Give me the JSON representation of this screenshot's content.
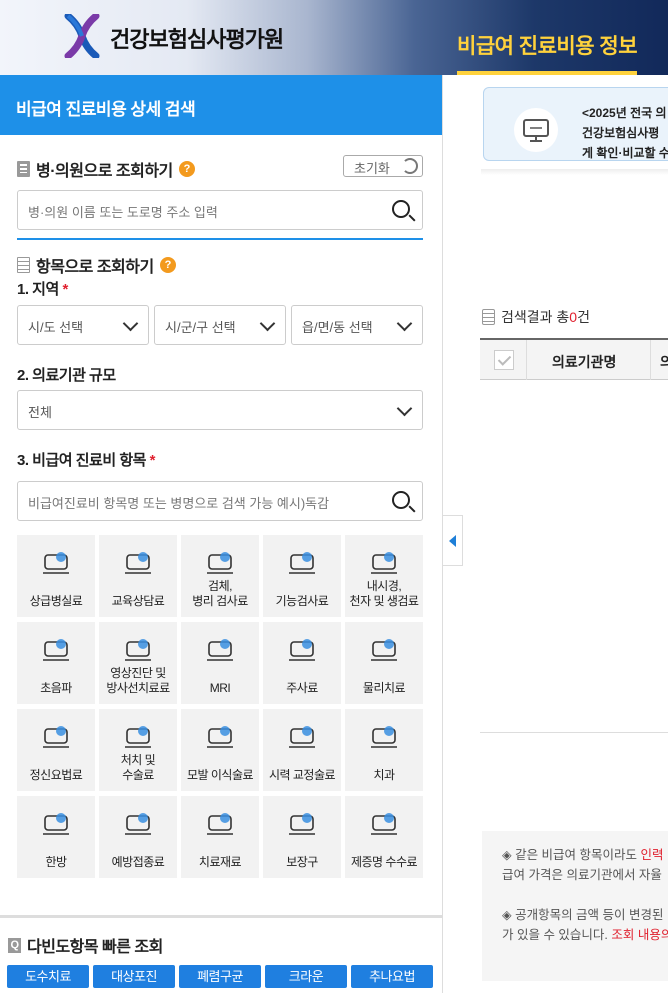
{
  "header": {
    "org_name": "건강보험심사평가원",
    "page_title": "비급여 진료비용 정보"
  },
  "left_panel": {
    "title": "비급여 진료비용 상세 검색",
    "hospital_search": {
      "title": "병·의원으로 조회하기",
      "reset_label": "초기화",
      "placeholder": "병·의원 이름 또는 도로명 주소 입력"
    },
    "item_search": {
      "title": "항목으로 조회하기",
      "region_label": "1. 지역",
      "region_selects": [
        "시/도 선택",
        "시/군/구 선택",
        "읍/면/동 선택"
      ],
      "scale_label": "2. 의료기관 규모",
      "scale_value": "전체",
      "item_label": "3. 비급여 진료비 항목",
      "item_placeholder": "비급여진료비 항목명 또는 병명으로 검색 가능 예시)독감",
      "categories": [
        {
          "label": "상급병실료",
          "icon": "hospital-bed-icon"
        },
        {
          "label": "교육상담료",
          "icon": "counseling-desk-icon"
        },
        {
          "label": "검체, 병리 검사료",
          "icon": "specimen-test-icon"
        },
        {
          "label": "기능검사료",
          "icon": "function-test-icon"
        },
        {
          "label": "내시경, 천자 및 생검료",
          "icon": "endoscope-icon"
        },
        {
          "label": "초음파",
          "icon": "ultrasound-icon"
        },
        {
          "label": "영상진단 및 방사선치료료",
          "icon": "radiology-icon"
        },
        {
          "label": "MRI",
          "icon": "mri-icon"
        },
        {
          "label": "주사료",
          "icon": "syringe-icon"
        },
        {
          "label": "물리치료",
          "icon": "physical-therapy-icon"
        },
        {
          "label": "정신요법료",
          "icon": "brain-wave-icon"
        },
        {
          "label": "처치 및 수술료",
          "icon": "surgery-icon"
        },
        {
          "label": "모발 이식술료",
          "icon": "hair-transplant-icon"
        },
        {
          "label": "시력 교정술료",
          "icon": "eye-laser-icon"
        },
        {
          "label": "치과",
          "icon": "tooth-icon"
        },
        {
          "label": "한방",
          "icon": "acupuncture-icon"
        },
        {
          "label": "예방접종료",
          "icon": "vaccine-icon"
        },
        {
          "label": "치료재료",
          "icon": "treatment-material-icon"
        },
        {
          "label": "보장구",
          "icon": "wheelchair-icon"
        },
        {
          "label": "제증명 수수료",
          "icon": "certificate-icon"
        }
      ]
    },
    "frequent": {
      "title": "다빈도항목 빠른 조회",
      "buttons": [
        "도수치료",
        "대상포진",
        "폐렴구균",
        "크라운",
        "추나요법"
      ]
    }
  },
  "right_panel": {
    "notice": {
      "line1": "<2025년 전국 의",
      "line2": "건강보험심사평",
      "line3": "게 확인·비교할 수"
    },
    "results": {
      "prefix": "검색결과 총",
      "count": "0",
      "suffix": "건"
    },
    "table_headers": [
      "의료기관명",
      "의"
    ],
    "info": {
      "p1_a": "◈ 같은 비급여 항목이라도 ",
      "p1_red": "인력",
      "p1_b": "급여 가격은 의료기관에서 자율",
      "p2_a": "◈ 공개항목의 금액 등이 변경된",
      "p2_b": "가 있을 수 있습니다. ",
      "p2_red": "조회 내용의"
    }
  },
  "colors": {
    "primary_blue": "#1e90e8",
    "button_blue": "#1f7fe0",
    "title_yellow": "#ffd23c",
    "help_orange": "#f39a1e",
    "required_red": "#e0202e"
  }
}
